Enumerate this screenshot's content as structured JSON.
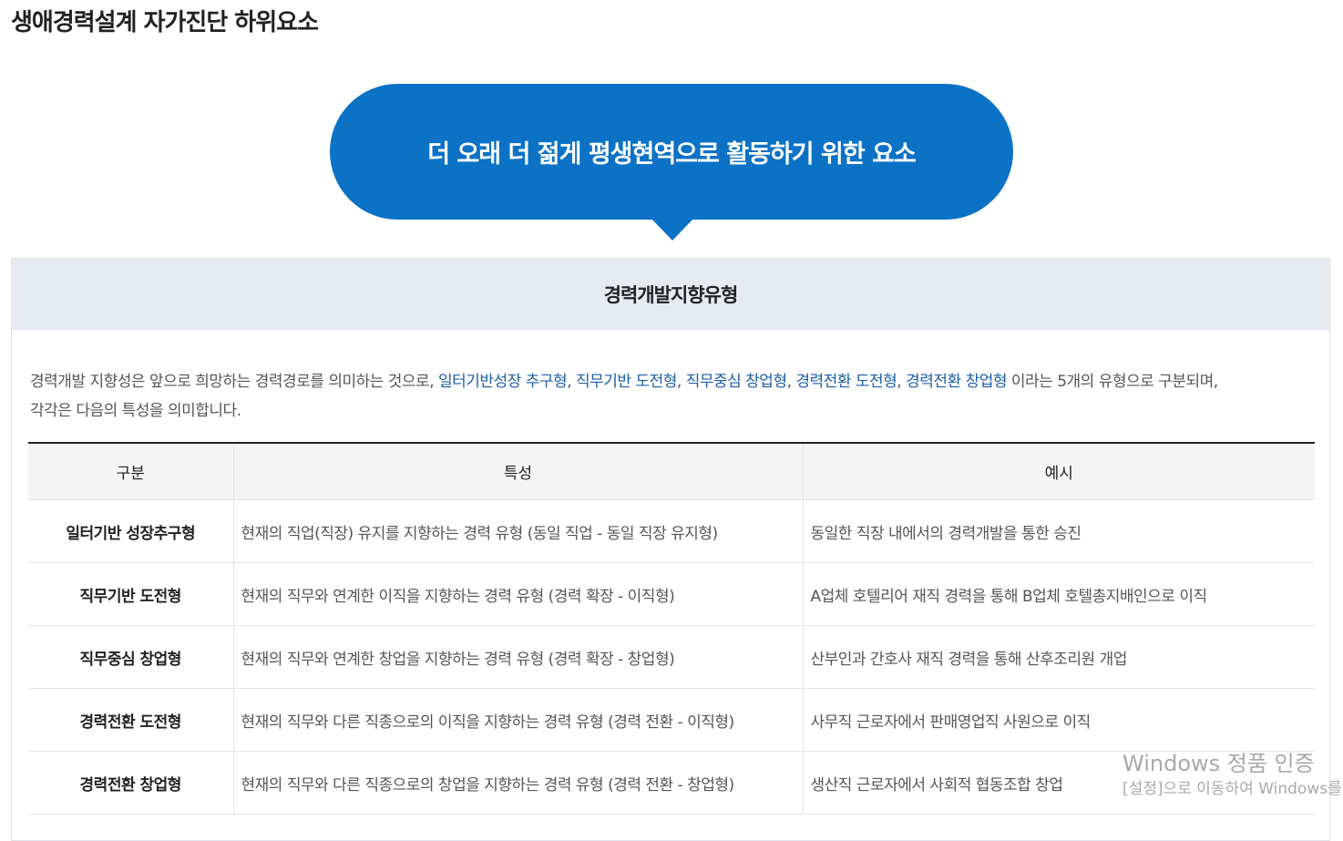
{
  "page": {
    "title": "생애경력설계 자가진단 하위요소"
  },
  "bubble": {
    "text": "더 오래 더 젊게 평생현역으로 활동하기 위한 요소"
  },
  "card": {
    "title": "경력개발지향유형",
    "description": {
      "prefix": "경력개발 지향성은 앞으로 희망하는 경력경로를 의미하는 것으로, ",
      "types": [
        "일터기반성장 추구형",
        "직무기반 도전형",
        "직무중심 창업형",
        "경력전환 도전형",
        "경력전환 창업형"
      ],
      "separator": ", ",
      "suffix": " 이라는 5개의 유형으로 구분되며,",
      "line2": "각각은 다음의 특성을 의미합니다."
    },
    "table": {
      "headers": [
        "구분",
        "특성",
        "예시"
      ],
      "rows": [
        {
          "kind": "일터기반 성장추구형",
          "trait": "현재의 직업(직장) 유지를 지향하는 경력 유형 (동일 직업 - 동일 직장 유지형)",
          "example": "동일한 직장 내에서의 경력개발을 통한 승진"
        },
        {
          "kind": "직무기반 도전형",
          "trait": "현재의 직무와 연계한 이직을 지향하는 경력 유형 (경력 확장 - 이직형)",
          "example": "A업체 호텔리어 재직 경력을 통해 B업체 호텔총지배인으로 이직"
        },
        {
          "kind": "직무중심 창업형",
          "trait": "현재의 직무와 연계한 창업을 지향하는 경력 유형 (경력 확장 - 창업형)",
          "example": "산부인과 간호사 재직 경력을 통해 산후조리원 개업"
        },
        {
          "kind": "경력전환 도전형",
          "trait": "현재의 직무와 다른 직종으로의 이직을 지향하는 경력 유형 (경력 전환 - 이직형)",
          "example": "사무직 근로자에서 판매영업직 사원으로 이직"
        },
        {
          "kind": "경력전환 창업형",
          "trait": "현재의 직무와 다른 직종으로의 창업을 지향하는 경력 유형 (경력 전환 - 창업형)",
          "example": "생산직 근로자에서 사회적 협동조합 창업"
        }
      ]
    }
  },
  "watermark": {
    "title": "Windows 정품 인증",
    "subtitle": "[설정]으로 이동하여 Windows를"
  },
  "colors": {
    "accent": "#0b72c6",
    "header_bg": "#e5ebf1",
    "link": "#1b5fa6"
  }
}
